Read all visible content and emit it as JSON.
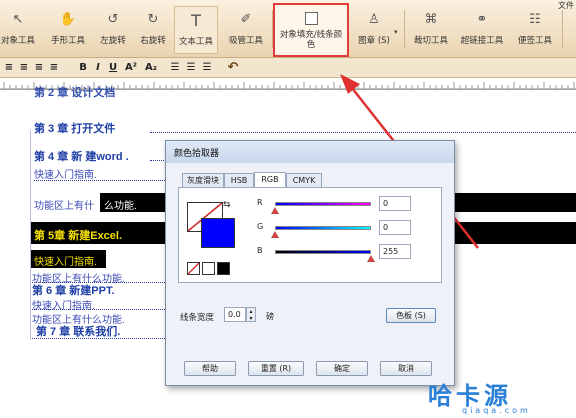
{
  "toolbar": {
    "tools": [
      {
        "label": "对象工具",
        "icon": "pointer-icon"
      },
      {
        "label": "手形工具",
        "icon": "hand-icon"
      },
      {
        "label": "左旋转",
        "icon": "rotate-left-icon"
      },
      {
        "label": "右旋转",
        "icon": "rotate-right-icon"
      },
      {
        "label": "文本工具",
        "icon": "text-icon"
      },
      {
        "label": "吸管工具",
        "icon": "eyedropper-icon"
      },
      {
        "label": "对象填充/线条颜色",
        "icon": "fill-square-icon"
      },
      {
        "label": "图章 (S)",
        "icon": "stamp-icon"
      },
      {
        "label": "裁切工具",
        "icon": "crop-icon"
      },
      {
        "label": "超链接工具",
        "icon": "link-icon"
      },
      {
        "label": "便签工具",
        "icon": "note-icon"
      }
    ],
    "top_right_text": "文件"
  },
  "formatbar": {
    "bold": "B",
    "italic": "I",
    "underline": "U",
    "superscript": "A²",
    "subscript": "A₂"
  },
  "document": {
    "chapter3": "第 3 章  打开文件",
    "chapter4": "第 4 章 新 建word .",
    "sub_quick1": "快速入门指南.",
    "func1_prefix": "功能区上有什",
    "func1_suffix": "么功能.",
    "chapter5": "第 5章  新建Excel.",
    "sub_quick2": "快速入门指南.",
    "func2": "功能区上有什么功能.",
    "chapter6": "第 6 章  新建PPT.",
    "sub_quick3": "快速入门指南.",
    "func3": "功能区上有什么功能.",
    "chapter7": "第 7 章  联系我们."
  },
  "dialog": {
    "title": "颜色拾取器",
    "tabs": [
      "灰度滑块",
      "HSB",
      "RGB",
      "CMYK"
    ],
    "active_tab": "RGB",
    "r_label": "R",
    "g_label": "G",
    "b_label": "B",
    "r_value": "0",
    "g_value": "0",
    "b_value": "255",
    "line_width_label": "线条宽度",
    "line_width_value": "0.0",
    "line_width_unit": "磅",
    "swatch_button": "色板 (S)",
    "help_button": "帮助",
    "reset_button": "重置 (R)",
    "ok_button": "确定",
    "cancel_button": "取消",
    "current_color": "#0000ff"
  },
  "watermark": {
    "logo_text": "哈卡源",
    "url": "qiaqa.com"
  },
  "colors": {
    "chapter_blue": "#1f3fa6",
    "highlight_red": "#e23b3b",
    "toolbar_bg": "#ead4b0"
  }
}
